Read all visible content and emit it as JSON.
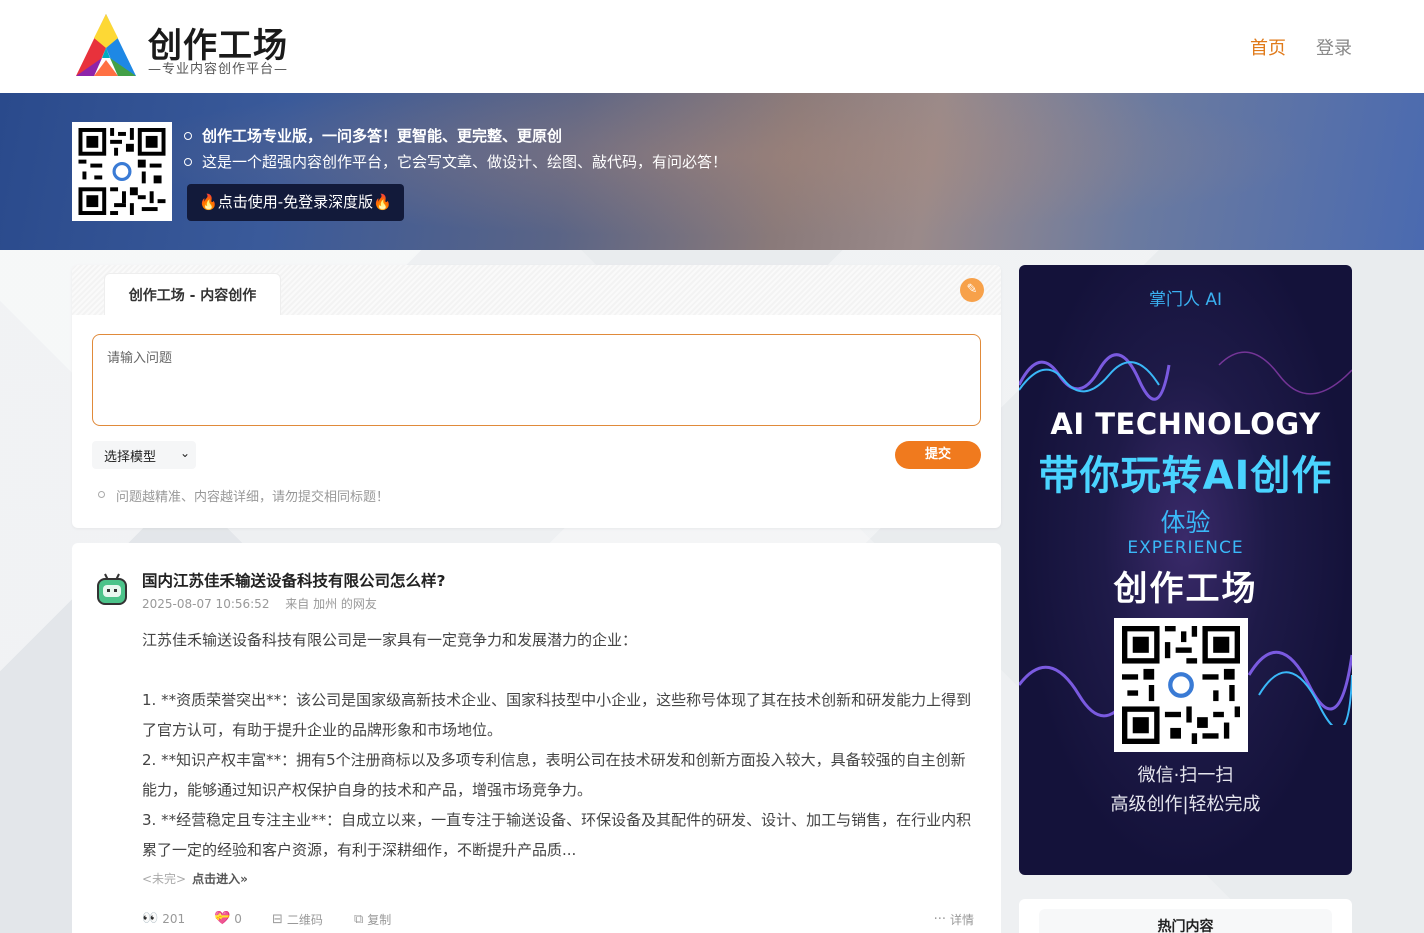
{
  "header": {
    "logo_title": "创作工场",
    "logo_subtitle": "—专业内容创作平台—",
    "nav": [
      {
        "label": "首页",
        "active": true
      },
      {
        "label": "登录",
        "active": false
      }
    ]
  },
  "banner": {
    "line1": "创作工场专业版，一问多答！更智能、更完整、更原创",
    "line2": "这是一个超强内容创作平台，它会写文章、做设计、绘图、敲代码，有问必答！",
    "button_label": "点击使用-免登录深度版",
    "button_icon": "🔥"
  },
  "composer": {
    "tab_label": "创作工场 - 内容创作",
    "input_placeholder": "请输入问题",
    "model_select": "选择模型",
    "submit_label": "提交",
    "hint": "问题越精准、内容越详细，请勿提交相同标题！"
  },
  "article": {
    "title": "国内江苏佳禾输送设备科技有限公司怎么样?",
    "date": "2025-08-07 10:56:52",
    "source": "来自 加州 的网友",
    "intro": "江苏佳禾输送设备科技有限公司是一家具有一定竞争力和发展潜力的企业：",
    "point1": "1. **资质荣誉突出**：该公司是国家级高新技术企业、国家科技型中小企业，这些称号体现了其在技术创新和研发能力上得到了官方认可，有助于提升企业的品牌形象和市场地位。",
    "point2": "2. **知识产权丰富**：拥有5个注册商标以及多项专利信息，表明公司在技术研发和创新方面投入较大，具备较强的自主创新能力，能够通过知识产权保护自身的技术和产品，增强市场竞争力。",
    "point3": "3. **经营稳定且专注主业**：自成立以来，一直专注于输送设备、环保设备及其配件的研发、设计、加工与销售，在行业内积累了一定的经验和客户资源，有利于深耕细作，不断提升产品质...",
    "unfinished": "<未完>",
    "enter_label": "点击进入»",
    "views": "201",
    "likes": "0",
    "qrcode_label": "二维码",
    "copy_label": "复制",
    "detail_label": "详情"
  },
  "ad": {
    "top": "掌门人 AI",
    "headline": "AI TECHNOLOGY",
    "subheadline": "带你玩转AI创作",
    "experience": "体验",
    "experience_en": "EXPERIENCE",
    "brand": "创作工场",
    "scan": "微信·扫一扫",
    "slogan": "高级创作|轻松完成"
  },
  "hot": {
    "title": "热门内容"
  },
  "colors": {
    "accent": "#f07a1e",
    "nav_active": "#e07a1a",
    "banner_button": "#121a3a",
    "ad_bg": "#1e1a48",
    "ad_cyan": "#4ad4ff"
  }
}
